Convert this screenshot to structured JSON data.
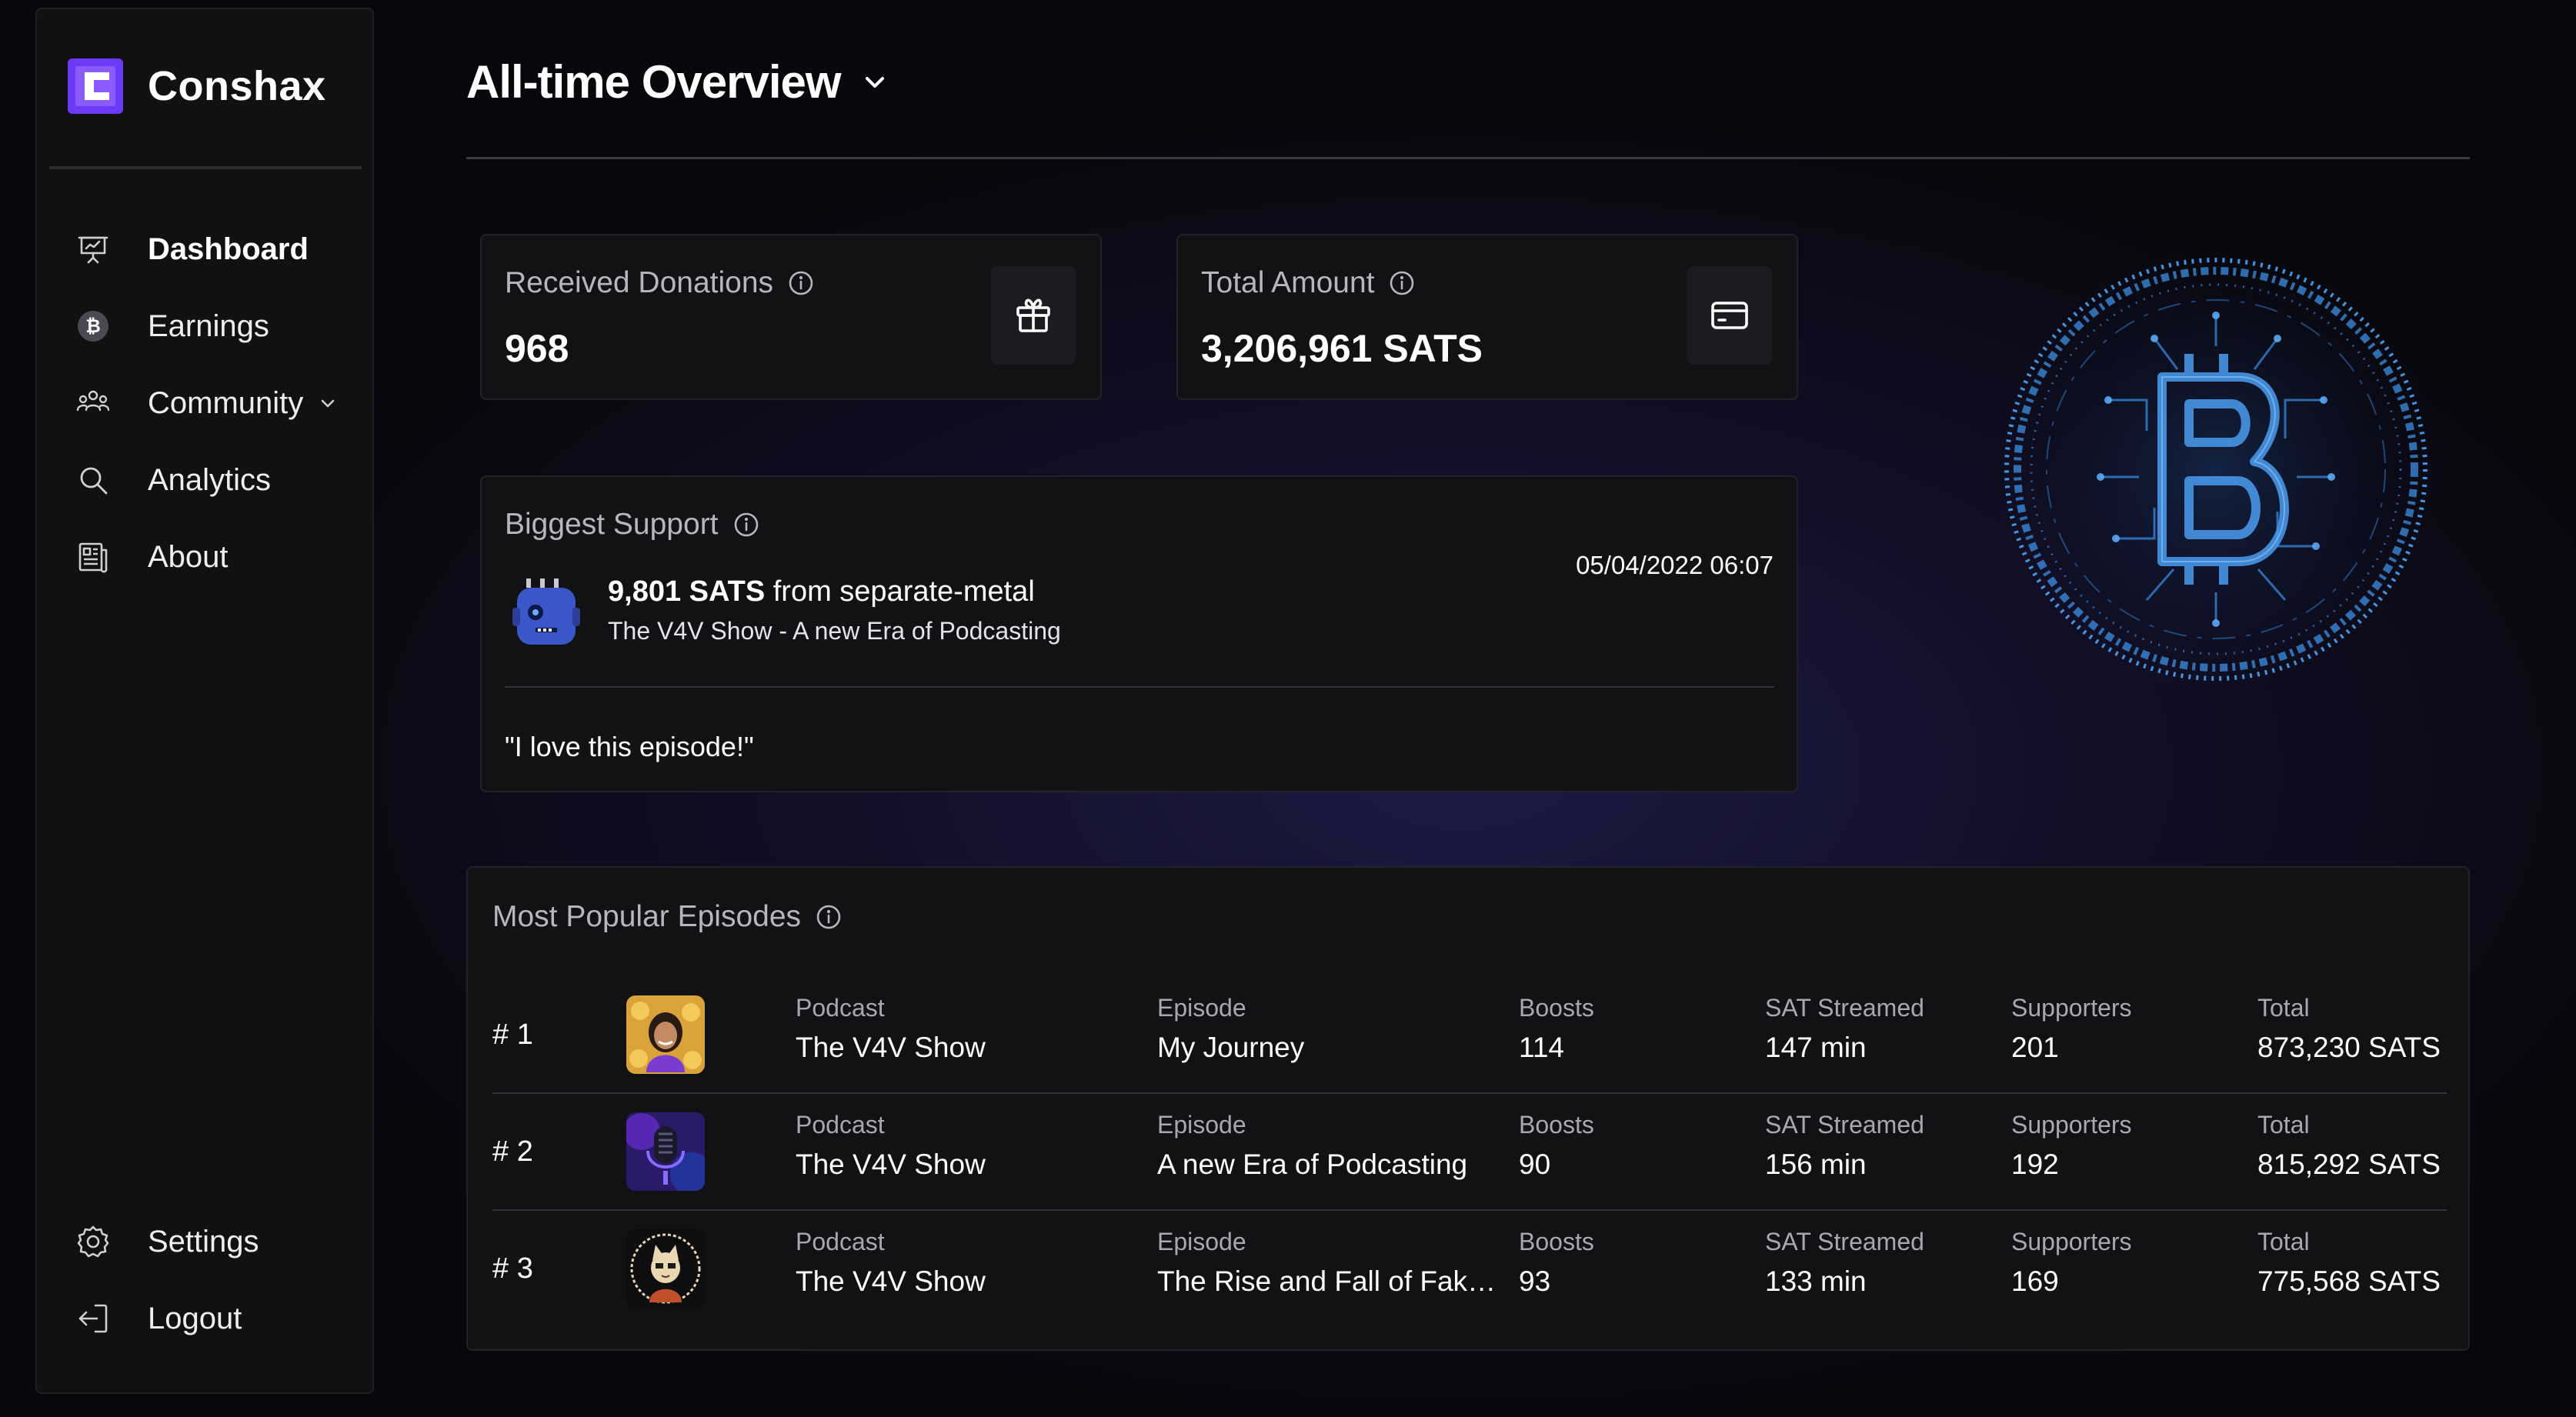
{
  "sidebar": {
    "brand": "Conshax",
    "items": [
      {
        "label": "Dashboard",
        "icon": "presentation-board-icon"
      },
      {
        "label": "Earnings",
        "icon": "bitcoin-icon"
      },
      {
        "label": "Community",
        "icon": "users-icon"
      },
      {
        "label": "Analytics",
        "icon": "search-icon"
      },
      {
        "label": "About",
        "icon": "newspaper-icon"
      }
    ],
    "bottom_items": [
      {
        "label": "Settings",
        "icon": "gear-icon"
      },
      {
        "label": "Logout",
        "icon": "logout-icon"
      }
    ],
    "active": "Dashboard"
  },
  "header": {
    "title": "All-time Overview"
  },
  "stats": {
    "received_donations": {
      "label": "Received Donations",
      "value": "968",
      "icon": "gift-icon"
    },
    "total_amount": {
      "label": "Total Amount",
      "value": "3,206,961 SATS",
      "icon": "credit-card-icon"
    }
  },
  "biggest_support": {
    "label": "Biggest Support",
    "amount": "9,801 SATS",
    "from_text": " from separate-metal",
    "episode": "The V4V Show - A new Era of Podcasting",
    "date": "05/04/2022 06:07",
    "message": "\"I love this episode!\""
  },
  "episodes": {
    "title": "Most Popular Episodes",
    "column_labels": {
      "podcast": "Podcast",
      "episode": "Episode",
      "boosts": "Boosts",
      "sat_streamed": "SAT Streamed",
      "supporters": "Supporters",
      "total": "Total"
    },
    "rows": [
      {
        "rank": "# 1",
        "podcast": "The V4V Show",
        "episode": "My Journey",
        "boosts": "114",
        "sat_streamed": "147 min",
        "supporters": "201",
        "total": "873,230 SATS"
      },
      {
        "rank": "# 2",
        "podcast": "The V4V Show",
        "episode": "A new Era of Podcasting",
        "boosts": "90",
        "sat_streamed": "156 min",
        "supporters": "192",
        "total": "815,292 SATS"
      },
      {
        "rank": "# 3",
        "podcast": "The V4V Show",
        "episode": "The Rise and Fall of Faketo...",
        "boosts": "93",
        "sat_streamed": "133 min",
        "supporters": "169",
        "total": "775,568 SATS"
      }
    ]
  },
  "colors": {
    "brand": "#6b3cf5",
    "background": "#0c0b16",
    "card": "#121214",
    "bitcoin_art": "#3a8fe6"
  }
}
